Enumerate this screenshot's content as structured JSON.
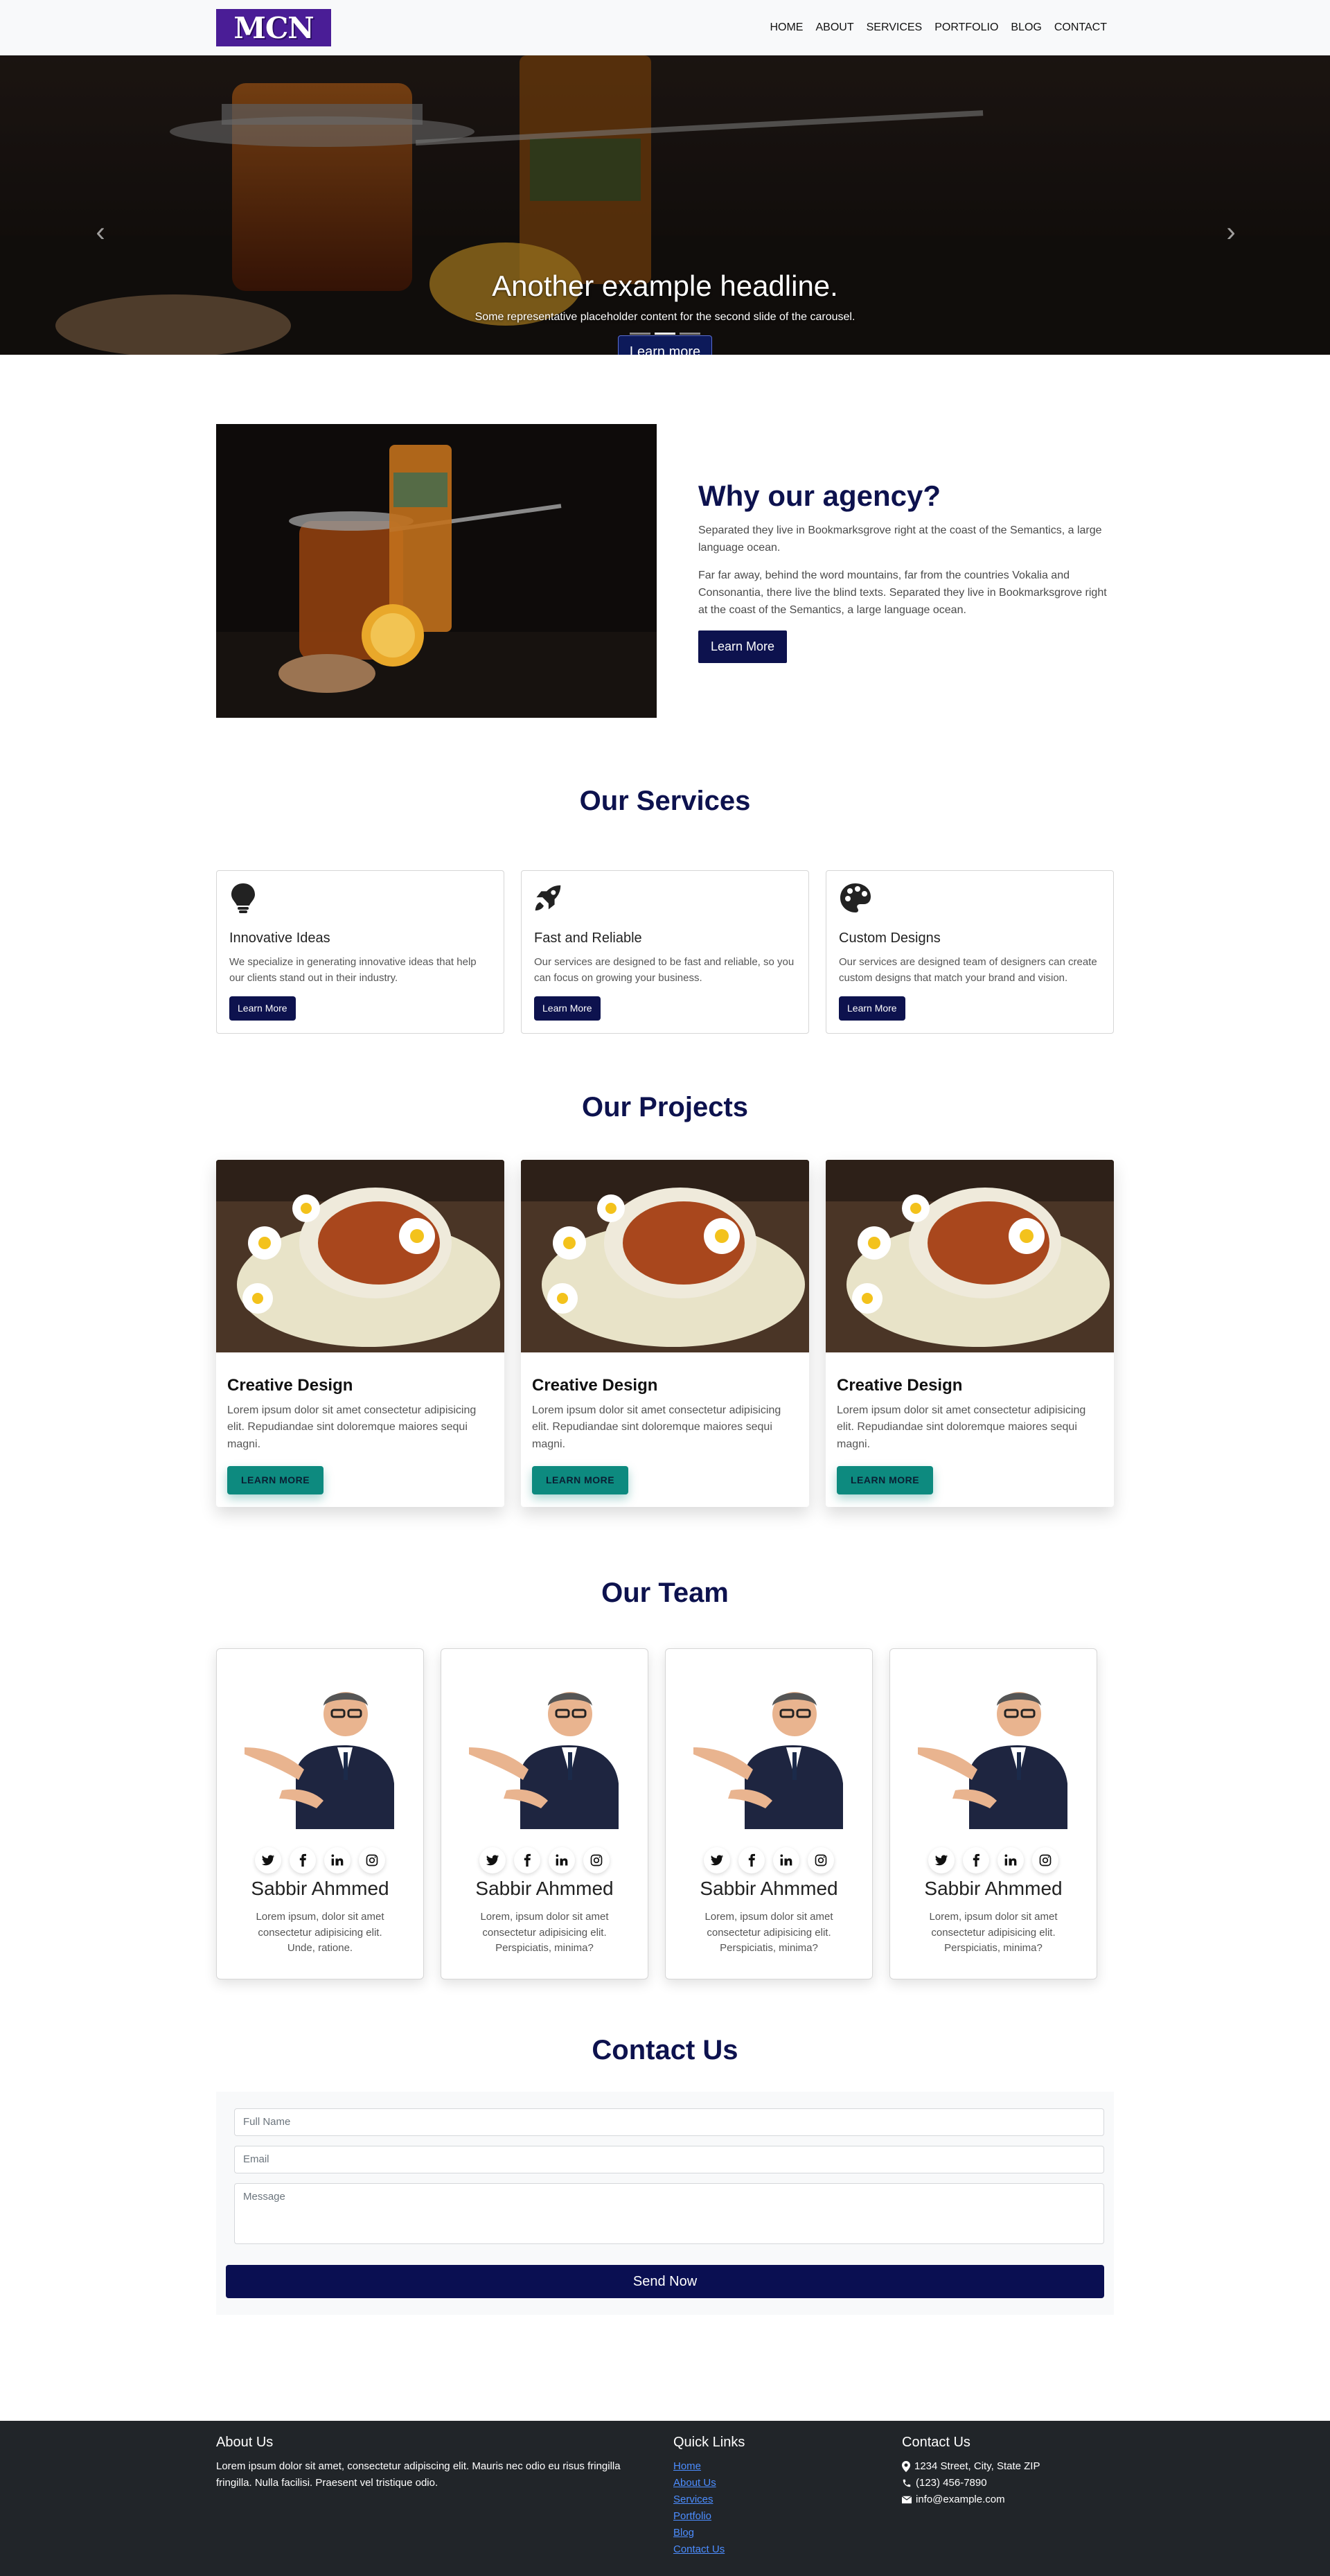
{
  "brand": {
    "logo_text": "MCN"
  },
  "nav": {
    "items": [
      "HOME",
      "ABOUT",
      "SERVICES",
      "PORTFOLIO",
      "BLOG",
      "CONTACT"
    ]
  },
  "hero": {
    "headline": "Another example headline.",
    "subtext": "Some representative placeholder content for the second slide of the carousel.",
    "button": "Learn more",
    "prev_icon": "chevron-left-icon",
    "next_icon": "chevron-right-icon",
    "active_slide": 2,
    "slide_count": 3
  },
  "about": {
    "title": "Why our agency?",
    "p1": "Separated they live in Bookmarksgrove right at the coast of the Semantics, a large language ocean.",
    "p2": "Far far away, behind the word mountains, far from the countries Vokalia and Consonantia, there live the blind texts. Separated they live in Bookmarksgrove right at the coast of the Semantics, a large language ocean.",
    "button": "Learn More"
  },
  "services": {
    "title": "Our Services",
    "items": [
      {
        "icon": "lightbulb-icon",
        "title": "Innovative Ideas",
        "text": "We specialize in generating innovative ideas that help our clients stand out in their industry.",
        "button": "Learn More"
      },
      {
        "icon": "rocket-icon",
        "title": "Fast and Reliable",
        "text": "Our services are designed to be fast and reliable, so you can focus on growing your business.",
        "button": "Learn More"
      },
      {
        "icon": "palette-icon",
        "title": "Custom Designs",
        "text": "Our services are designed team of designers can create custom designs that match your brand and vision.",
        "button": "Learn More"
      }
    ]
  },
  "projects": {
    "title": "Our Projects",
    "items": [
      {
        "title": "Creative Design",
        "text": "Lorem ipsum dolor sit amet consectetur adipisicing elit. Repudiandae sint doloremque maiores sequi magni.",
        "button": "LEARN MORE"
      },
      {
        "title": "Creative Design",
        "text": "Lorem ipsum dolor sit amet consectetur adipisicing elit. Repudiandae sint doloremque maiores sequi magni.",
        "button": "LEARN MORE"
      },
      {
        "title": "Creative Design",
        "text": "Lorem ipsum dolor sit amet consectetur adipisicing elit. Repudiandae sint doloremque maiores sequi magni.",
        "button": "LEARN MORE"
      }
    ]
  },
  "team": {
    "title": "Our Team",
    "members": [
      {
        "name": "Sabbir Ahmmed",
        "bio": "Lorem ipsum, dolor sit amet consectetur adipisicing elit. Unde, ratione."
      },
      {
        "name": "Sabbir Ahmmed",
        "bio": "Lorem, ipsum dolor sit amet consectetur adipisicing elit. Perspiciatis, minima?"
      },
      {
        "name": "Sabbir Ahmmed",
        "bio": "Lorem, ipsum dolor sit amet consectetur adipisicing elit. Perspiciatis, minima?"
      },
      {
        "name": "Sabbir Ahmmed",
        "bio": "Lorem, ipsum dolor sit amet consectetur adipisicing elit. Perspiciatis, minima?"
      }
    ],
    "social_icons": [
      "twitter-icon",
      "facebook-icon",
      "linkedin-icon",
      "instagram-icon"
    ]
  },
  "contact": {
    "title": "Contact Us",
    "name_placeholder": "Full Name",
    "email_placeholder": "Email",
    "message_placeholder": "Message",
    "button": "Send Now"
  },
  "footer": {
    "about_title": "About Us",
    "about_text": "Lorem ipsum dolor sit amet, consectetur adipiscing elit. Mauris nec odio eu risus fringilla fringilla. Nulla facilisi. Praesent vel tristique odio.",
    "links_title": "Quick Links",
    "links": [
      "Home",
      "About Us",
      "Services",
      "Portfolio",
      "Blog",
      "Contact Us"
    ],
    "contact_title": "Contact Us",
    "address": "1234 Street, City, State ZIP",
    "phone": "(123) 456-7890",
    "email": "info@example.com"
  },
  "colors": {
    "navy": "#0d124e",
    "teal": "#0d8a7f",
    "footer_bg": "#212529",
    "logo_bg": "#4a1d96"
  }
}
